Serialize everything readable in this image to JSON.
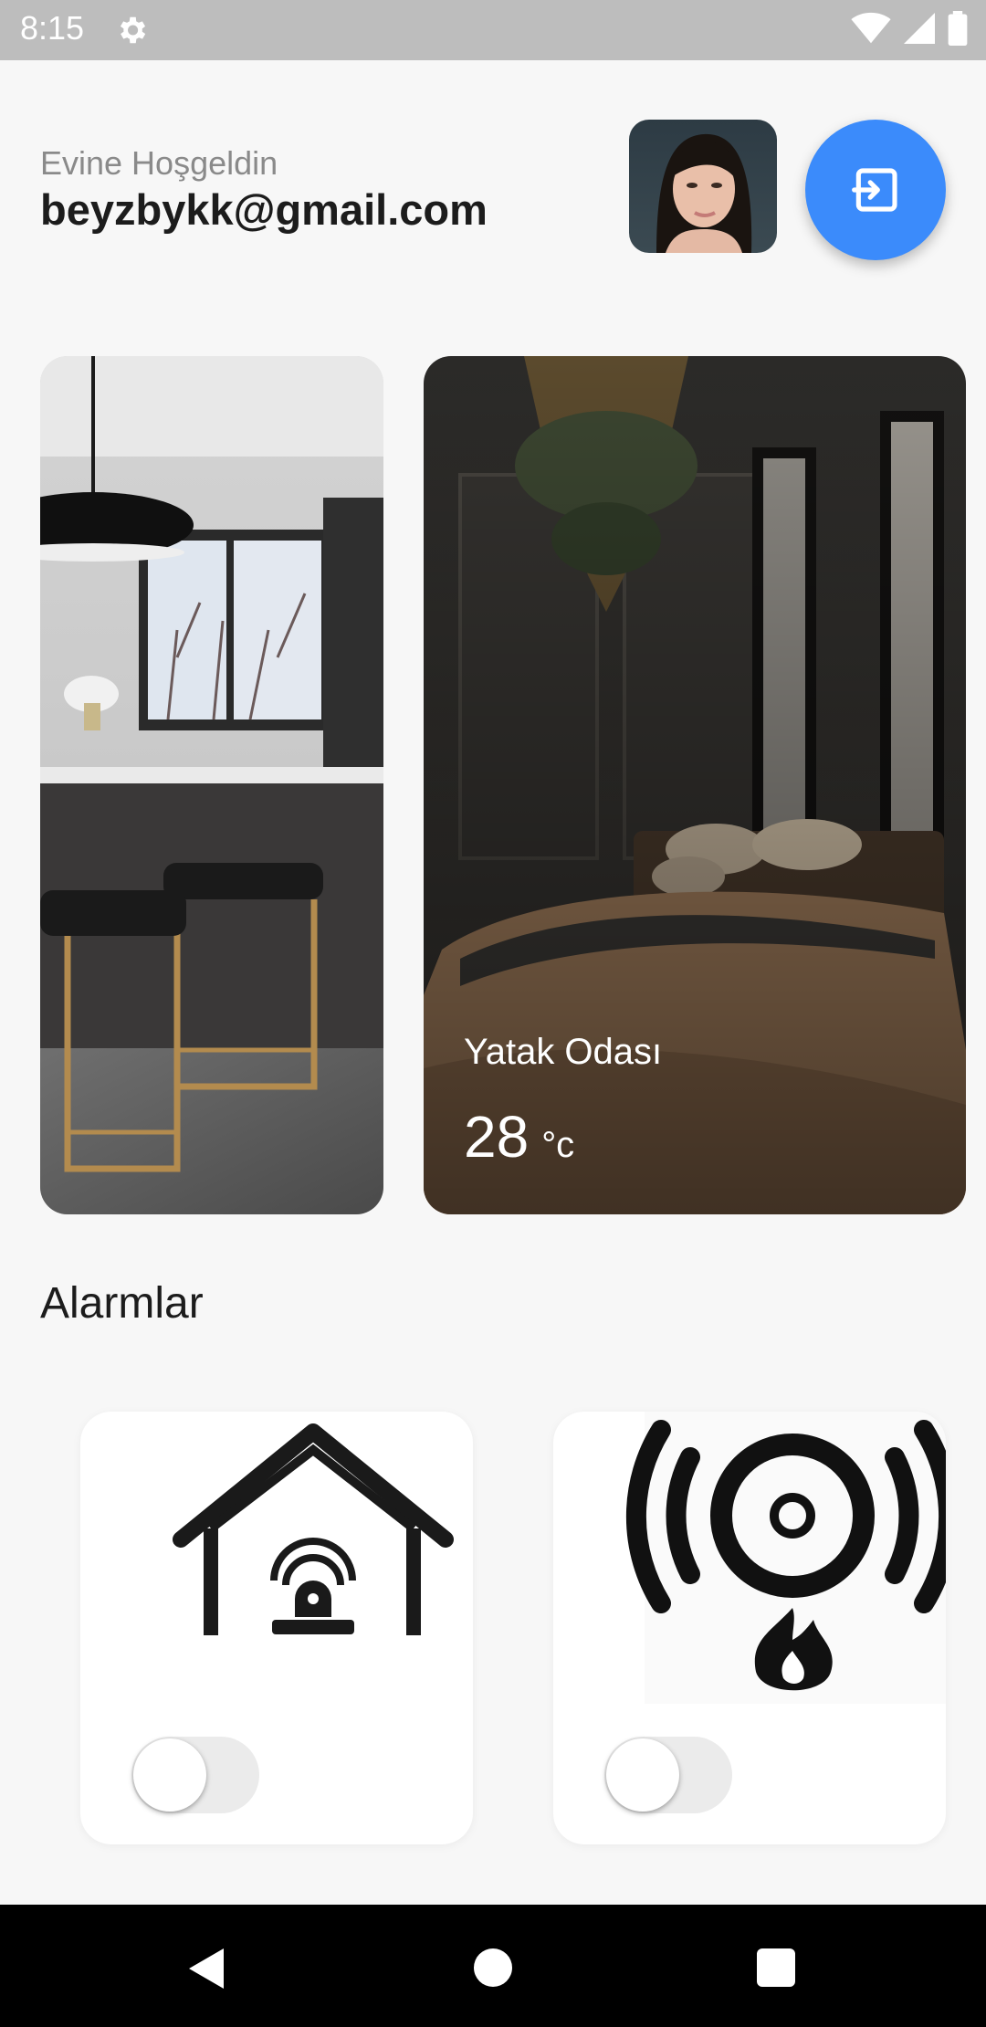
{
  "status_bar": {
    "time": "8:15",
    "icons": [
      "settings-icon",
      "wifi-icon",
      "signal-icon",
      "battery-icon"
    ]
  },
  "header": {
    "greeting": "Evine Hoşgeldin",
    "email": "beyzbykk@gmail.com",
    "logout_icon": "login-icon",
    "accent_color": "#3b8bfb"
  },
  "rooms": [
    {
      "name": "",
      "image": "kitchen-photo"
    },
    {
      "name": "Yatak Odası",
      "temperature": "28",
      "unit": "°c",
      "image": "bedroom-photo"
    }
  ],
  "alarms": {
    "title": "Alarmlar",
    "items": [
      {
        "icon": "home-siren-icon",
        "enabled": false
      },
      {
        "icon": "fire-alarm-icon",
        "enabled": false
      }
    ]
  },
  "nav_bar": {
    "buttons": [
      "back-icon",
      "home-icon",
      "recents-icon"
    ]
  }
}
